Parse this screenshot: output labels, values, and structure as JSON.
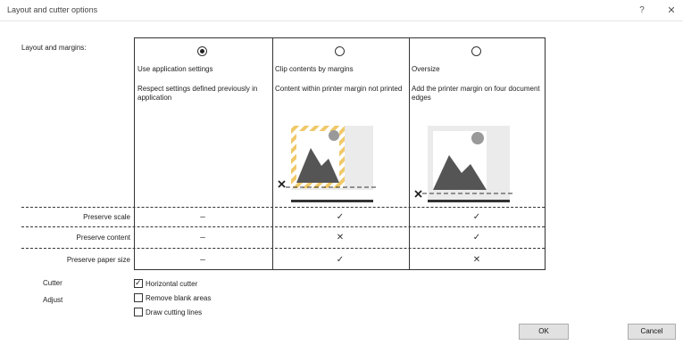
{
  "window": {
    "title": "Layout and cutter options",
    "help_label": "?",
    "close_label": "✕"
  },
  "layout": {
    "section_label": "Layout and margins:",
    "options": [
      {
        "title": "Use application settings",
        "description": "Respect settings defined previously in application",
        "selected": true
      },
      {
        "title": "Clip contents by margins",
        "description": "Content within printer margin not printed",
        "selected": false
      },
      {
        "title": "Oversize",
        "description": "Add the printer margin on four document edges",
        "selected": false
      }
    ],
    "rows": [
      {
        "label": "Preserve scale",
        "values": [
          "–",
          "✓",
          "✓"
        ]
      },
      {
        "label": "Preserve content",
        "values": [
          "–",
          "✕",
          "✓"
        ]
      },
      {
        "label": "Preserve paper size",
        "values": [
          "–",
          "✓",
          "✕"
        ]
      }
    ]
  },
  "cutter": {
    "label": "Cutter",
    "horizontal_cutter": {
      "label": "Horizontal cutter",
      "checked": true
    }
  },
  "adjust": {
    "label": "Adjust",
    "remove_blank_areas": {
      "label": "Remove blank areas",
      "checked": false
    },
    "draw_cutting_lines": {
      "label": "Draw cutting lines",
      "checked": false
    }
  },
  "buttons": {
    "ok": "OK",
    "cancel": "Cancel"
  },
  "colors": {
    "stripe": "#f0c868",
    "image_gray": "#555555",
    "sun_gray": "#999999",
    "paper_bg": "#ebebeb"
  },
  "icons": [
    "help-icon",
    "close-icon",
    "landscape-image-icon",
    "cut-mark-icon"
  ]
}
